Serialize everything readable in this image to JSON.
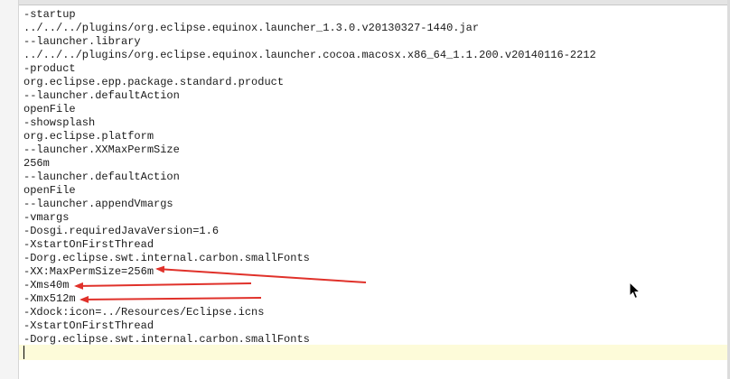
{
  "editor": {
    "lines": [
      "-startup",
      "../../../plugins/org.eclipse.equinox.launcher_1.3.0.v20130327-1440.jar",
      "--launcher.library",
      "../../../plugins/org.eclipse.equinox.launcher.cocoa.macosx.x86_64_1.1.200.v20140116-2212",
      "-product",
      "org.eclipse.epp.package.standard.product",
      "--launcher.defaultAction",
      "openFile",
      "-showsplash",
      "org.eclipse.platform",
      "--launcher.XXMaxPermSize",
      "256m",
      "--launcher.defaultAction",
      "openFile",
      "--launcher.appendVmargs",
      "-vmargs",
      "-Dosgi.requiredJavaVersion=1.6",
      "-XstartOnFirstThread",
      "-Dorg.eclipse.swt.internal.carbon.smallFonts",
      "-XX:MaxPermSize=256m",
      "-Xms40m",
      "-Xmx512m",
      "-Xdock:icon=../Resources/Eclipse.icns",
      "-XstartOnFirstThread",
      "-Dorg.eclipse.swt.internal.carbon.smallFonts"
    ]
  },
  "annotations": {
    "arrow_color": "#e0312a",
    "highlighted_lines": [
      "-XX:MaxPermSize=256m",
      "-Xms40m",
      "-Xmx512m"
    ]
  },
  "colors": {
    "current_line": "#fdfbd9",
    "text": "#1a1a1a"
  }
}
